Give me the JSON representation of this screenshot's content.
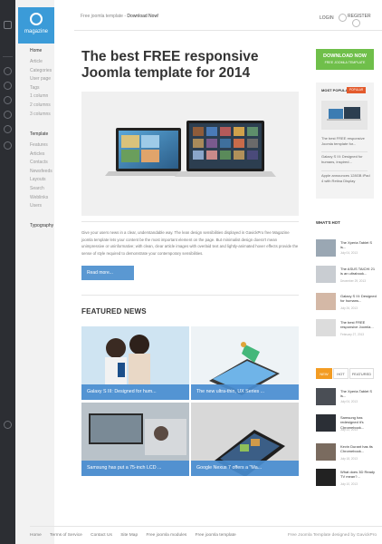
{
  "header": {
    "logo_text": "magazine",
    "promo_prefix": "Free joomla template - ",
    "promo_link": "Download Now!",
    "login": "LOGIN",
    "register": "REGISTER"
  },
  "nav": {
    "group1": {
      "title": "Home",
      "items": [
        "Article",
        "Categories",
        "User page",
        "Tags",
        "1 column",
        "2 columns",
        "3 columns"
      ]
    },
    "group2": {
      "title": "Template",
      "items": [
        "Features",
        "Articles",
        "Contacts",
        "Newsfeeds",
        "Layouts",
        "Search",
        "Weblinks",
        "Users"
      ]
    },
    "group3": {
      "title": "Typography"
    }
  },
  "article": {
    "title": "The best FREE responsive Joomla template for 2014",
    "excerpt": "Give your users news in a clear, understandable way. The lean design sensibilities displayed in GavickPro free Magazine joomla template lets your content be the most important element on the page. But minimalist design doesn't mean unimpressive or uninformative; with clean, clear article images with overlaid text and lightly-animated hover effects provide the sense of style required to demonstrate your contemporary sensibilities.",
    "read_more": "Read more..."
  },
  "featured": {
    "heading": "FEATURED NEWS",
    "items": [
      {
        "caption": "Galaxy S III: Designed for hum..."
      },
      {
        "caption": "The new ultra-thin, UX Series ..."
      },
      {
        "caption": "Samsung has put a 75-inch LCD ..."
      },
      {
        "caption": "Google Nexus 7 offers a \"Ma..."
      }
    ]
  },
  "download": {
    "label": "DOWNLOAD NOW",
    "sub": "FREE JOOMLA TEMPLATE"
  },
  "most_popular": {
    "heading": "MOST POPULAR",
    "tag": "POPULAR",
    "items": [
      "The best FREE responsive Joomla template for...",
      "Galaxy S III: Designed for humans, inspired...",
      "Apple announces 128GB iPad 4 with Retina Display"
    ]
  },
  "whats_hot": {
    "heading": "WHAT'S HOT",
    "items": [
      {
        "title": "The Xperia Tablet S is...",
        "date": "July 04, 2013"
      },
      {
        "title": "The ASUS TAICHI 21 is an ultrabook...",
        "date": "December 29, 2013"
      },
      {
        "title": "Galaxy S III: Designed for humans...",
        "date": "July 26, 2013"
      },
      {
        "title": "The best FREE responsive Joomla...",
        "date": "February 27, 2013"
      }
    ]
  },
  "tabs": {
    "items": [
      "NEW",
      "HOT",
      "FEATURED"
    ],
    "list": [
      {
        "title": "The Xperia Tablet S is...",
        "date": "July 04, 2013"
      },
      {
        "title": "Samsung has redesigned it's Chromebook...",
        "date": "July 22, 2013"
      },
      {
        "title": "Kevin Durant has its Chromebook...",
        "date": "July 18, 2013"
      },
      {
        "title": "What does 3D Ready TV mean?...",
        "date": "July 10, 2013"
      }
    ]
  },
  "footer": {
    "links": [
      "Home",
      "Terms of Service",
      "Contact Us",
      "Site Map",
      "Free joomla modules",
      "Free joomla template"
    ],
    "credit": "Free Joomla Template designed by GavickPro"
  },
  "colors": {
    "accent_blue": "#3b9bd8",
    "read_more_blue": "#5a98d2",
    "caption_blue": "#498dd0",
    "download_green": "#6fbf4a",
    "popular_tag": "#e35a2c",
    "tab_active": "#f39c23"
  }
}
